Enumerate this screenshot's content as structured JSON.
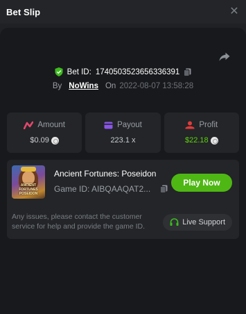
{
  "header": {
    "title": "Bet Slip",
    "close_icon": "close-icon"
  },
  "bet": {
    "id_label": "Bet ID:",
    "id_value": "1740503523656336391",
    "by_label": "By",
    "user": "NoWins",
    "on_label": "On",
    "timestamp": "2022-08-07 13:58:28"
  },
  "stats": {
    "amount": {
      "label": "Amount",
      "value": "$0.09"
    },
    "payout": {
      "label": "Payout",
      "value": "223.1 x"
    },
    "profit": {
      "label": "Profit",
      "value": "$22.18"
    }
  },
  "game": {
    "name": "Ancient Fortunes: Poseidon",
    "id_text": "Game ID: AIBQAAQAT2...",
    "thumb_title": "ANCIENT FORTUNES POSEIDON",
    "play_label": "Play Now",
    "notice": "Any issues, please contact the customer service for help and provide the game ID.",
    "support_label": "Live Support"
  },
  "colors": {
    "accent_green": "#4fb714",
    "profit_green": "#5dd10e",
    "amount_icon": "#e4476b",
    "payout_icon": "#8a56e8",
    "profit_icon": "#e23b3b"
  }
}
